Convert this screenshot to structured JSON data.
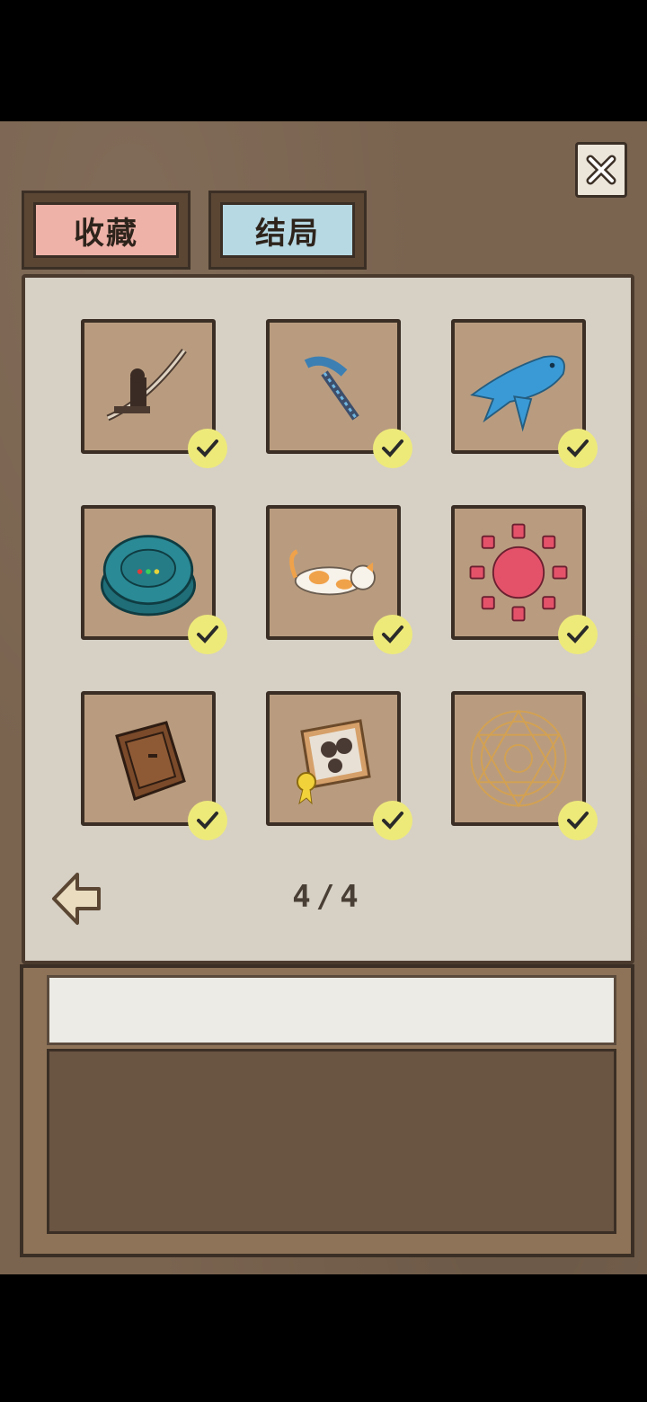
{
  "tabs": [
    {
      "label": "收藏",
      "color": "#efb2a8"
    },
    {
      "label": "结局",
      "color": "#b7d9e4"
    }
  ],
  "items": [
    {
      "name": "crossbow-icon",
      "collected": true
    },
    {
      "name": "pixel-pickaxe-icon",
      "collected": true
    },
    {
      "name": "blue-fish-icon",
      "collected": true
    },
    {
      "name": "robot-vacuum-icon",
      "collected": true
    },
    {
      "name": "calico-cat-icon",
      "collected": true
    },
    {
      "name": "sun-puzzle-icon",
      "collected": true
    },
    {
      "name": "wooden-drawer-icon",
      "collected": true
    },
    {
      "name": "framed-photo-icon",
      "collected": true
    },
    {
      "name": "magic-circle-icon",
      "collected": true
    }
  ],
  "pagination": {
    "text": "4/4",
    "current": 4,
    "total": 4
  },
  "description": {
    "title": "",
    "body": ""
  },
  "colors": {
    "check": "#eeea7a",
    "slot": "#b99c7f",
    "panel": "#d6d0c5"
  }
}
